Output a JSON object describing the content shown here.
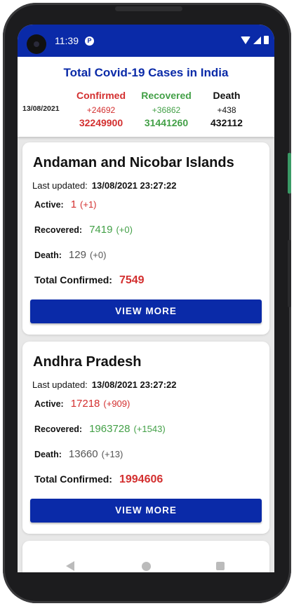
{
  "status_bar": {
    "time": "11:39"
  },
  "summary": {
    "title": "Total Covid-19 Cases in India",
    "date": "13/08/2021",
    "confirmed": {
      "label": "Confirmed",
      "delta": "+24692",
      "total": "32249900"
    },
    "recovered": {
      "label": "Recovered",
      "delta": "+36862",
      "total": "31441260"
    },
    "death": {
      "label": "Death",
      "delta": "+438",
      "total": "432112"
    }
  },
  "labels": {
    "last_updated": "Last updated:",
    "active": "Active:",
    "recovered": "Recovered:",
    "death": "Death:",
    "total_confirmed": "Total Confirmed:",
    "view_more": "VIEW MORE"
  },
  "states": [
    {
      "name": "Andaman and Nicobar Islands",
      "updated": "13/08/2021 23:27:22",
      "active": "1",
      "active_delta": "(+1)",
      "recovered": "7419",
      "recovered_delta": "(+0)",
      "death": "129",
      "death_delta": "(+0)",
      "total_confirmed": "7549"
    },
    {
      "name": "Andhra Pradesh",
      "updated": "13/08/2021 23:27:22",
      "active": "17218",
      "active_delta": "(+909)",
      "recovered": "1963728",
      "recovered_delta": "(+1543)",
      "death": "13660",
      "death_delta": "(+13)",
      "total_confirmed": "1994606"
    }
  ],
  "colors": {
    "primary": "#0a2aa8",
    "confirmed": "#d32f2f",
    "recovered": "#43a047"
  },
  "icons": [
    "wifi-icon",
    "signal-icon",
    "battery-icon",
    "back-icon",
    "home-icon",
    "recents-icon"
  ]
}
